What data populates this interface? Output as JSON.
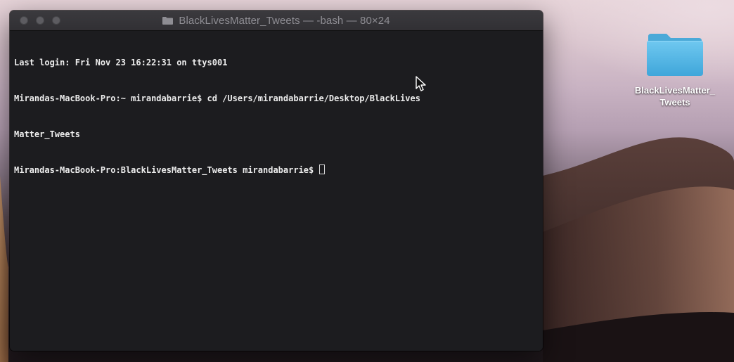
{
  "window": {
    "title": "BlackLivesMatter_Tweets — -bash — 80×24"
  },
  "terminal": {
    "lines": [
      "Last login: Fri Nov 23 16:22:31 on ttys001",
      "Mirandas-MacBook-Pro:~ mirandabarrie$ cd /Users/mirandabarrie/Desktop/BlackLives",
      "Matter_Tweets",
      "Mirandas-MacBook-Pro:BlackLivesMatter_Tweets mirandabarrie$ "
    ]
  },
  "desktop": {
    "folder_label_line1": "BlackLivesMatter_",
    "folder_label_line2": "Tweets"
  },
  "icons": {
    "title_folder": "folder-icon",
    "desktop_folder": "folder-icon",
    "pointer": "mouse-pointer-icon"
  },
  "colors": {
    "terminal_bg": "#1c1c1f",
    "terminal_text": "#ececec",
    "folder_blue": "#5ab9e6"
  }
}
